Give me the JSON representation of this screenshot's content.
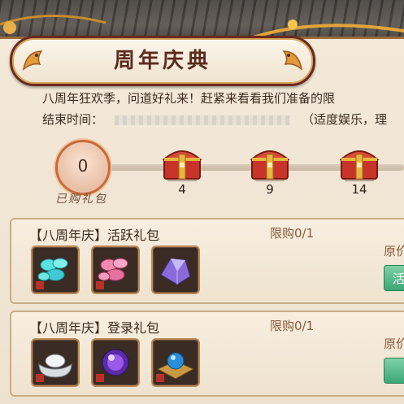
{
  "title": "周年庆典",
  "description": {
    "line1": "八周年狂欢季，问道好礼来！赶紧来看看我们准备的限",
    "line2_prefix": "结束时间：",
    "line2_suffix": "（适度娱乐，理"
  },
  "progress": {
    "purchased_count": "0",
    "purchased_label": "已购礼包",
    "milestones": [
      "4",
      "9",
      "14"
    ]
  },
  "gifts": [
    {
      "title": "【八周年庆】活跃礼包",
      "limit": "限购0/1",
      "original_price_label": "原价",
      "button_label": "活",
      "items": [
        "cyan-gems-icon",
        "pink-gems-icon",
        "purple-crystal-icon"
      ]
    },
    {
      "title": "【八周年庆】登录礼包",
      "limit": "限购0/1",
      "original_price_label": "原价",
      "button_label": "",
      "items": [
        "silver-ingot-icon",
        "purple-orb-icon",
        "blue-orb-board-icon"
      ]
    }
  ],
  "colors": {
    "title_border": "#6a2a1c",
    "button_green": "#3ba775",
    "limit_text": "#8a5a3a"
  }
}
